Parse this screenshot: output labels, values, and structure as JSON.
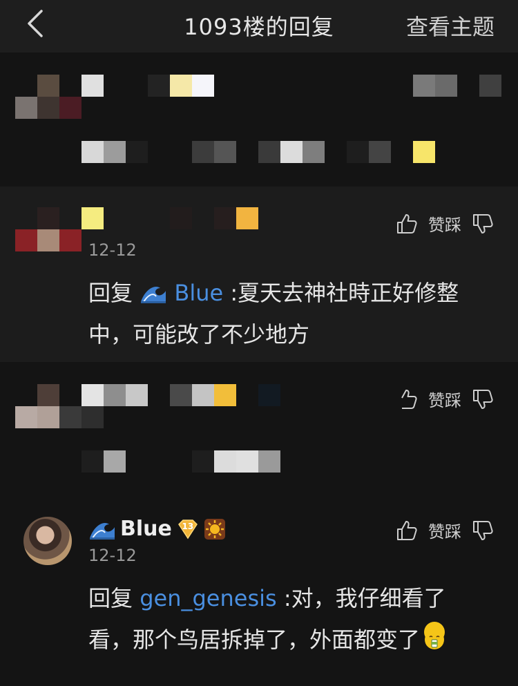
{
  "header": {
    "title": "1093楼的回复",
    "topic_link": "查看主题"
  },
  "colors": {
    "mention": "#4a8fe0",
    "background": "#1a1a1a"
  },
  "actions": {
    "like_label": "赞",
    "dislike_label": "踩"
  },
  "replies": [
    {
      "date": "12-12",
      "reply_prefix": "回复",
      "mention": "Blue",
      "text_line1": ":夏天去神社時正好修整",
      "text_line2": "中，可能改了不少地方"
    },
    {
      "user": "Blue",
      "level": "13",
      "date": "12-12",
      "reply_prefix": "回复",
      "mention": "gen_genesis",
      "text_line1": ":对，我仔细看了",
      "text_line2": "看，那个鸟居拆掉了，外面都变了"
    }
  ]
}
